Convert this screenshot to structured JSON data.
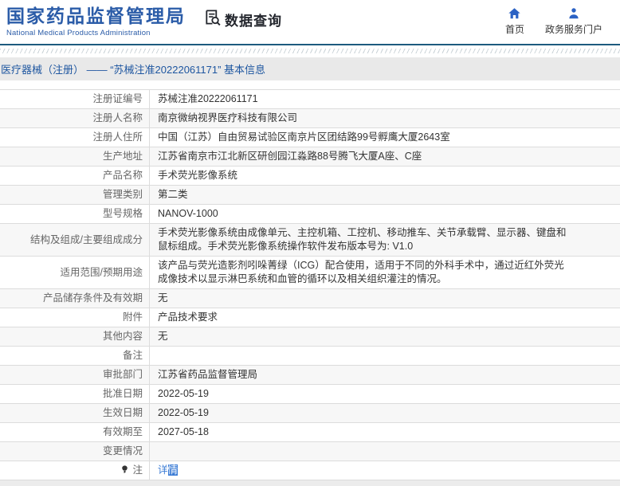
{
  "header": {
    "logo_title": "国家药品监督管理局",
    "logo_subtitle": "National Medical Products Administration",
    "site_title": "数据查询",
    "nav": [
      {
        "label": "首页"
      },
      {
        "label": "政务服务门户"
      }
    ]
  },
  "breadcrumb": "医疗器械（注册） —— “苏械注准20222061171” 基本信息",
  "table": {
    "rows": [
      {
        "label": "注册证编号",
        "value": "苏械注准20222061171"
      },
      {
        "label": "注册人名称",
        "value": "南京微纳视界医疗科技有限公司"
      },
      {
        "label": "注册人住所",
        "value": "中国（江苏）自由贸易试验区南京片区团结路99号孵鹰大厦2643室"
      },
      {
        "label": "生产地址",
        "value": "江苏省南京市江北新区研创园江淼路88号腾飞大厦A座、C座"
      },
      {
        "label": "产品名称",
        "value": "手术荧光影像系统"
      },
      {
        "label": "管理类别",
        "value": "第二类"
      },
      {
        "label": "型号规格",
        "value": "NANOV-1000"
      },
      {
        "label": "结构及组成/主要组成成分",
        "value": "手术荧光影像系统由成像单元、主控机箱、工控机、移动推车、关节承载臂、显示器、键盘和鼠标组成。手术荧光影像系统操作软件发布版本号为: V1.0"
      },
      {
        "label": "适用范围/预期用途",
        "value": "该产品与荧光造影剂吲哚菁绿（ICG）配合使用，适用于不同的外科手术中，通过近红外荧光成像技术以显示淋巴系统和血管的循环以及相关组织灌注的情况。"
      },
      {
        "label": "产品储存条件及有效期",
        "value": "无"
      },
      {
        "label": "附件",
        "value": "产品技术要求"
      },
      {
        "label": "其他内容",
        "value": "无"
      },
      {
        "label": "备注",
        "value": ""
      },
      {
        "label": "审批部门",
        "value": "江苏省药品监督管理局"
      },
      {
        "label": "批准日期",
        "value": "2022-05-19"
      },
      {
        "label": "生效日期",
        "value": "2022-05-19"
      },
      {
        "label": "有效期至",
        "value": "2027-05-18"
      },
      {
        "label": "变更情况",
        "value": ""
      },
      {
        "label": "注",
        "value": "详情",
        "type": "link",
        "label_icon": "note-icon",
        "selected_from": 1
      }
    ]
  },
  "colors": {
    "brand": "#2b5ca8",
    "icon-blue": "#2b62c4",
    "link": "#3a7bd5",
    "divider": "#1d5b7f",
    "row-alt": "#f7f7f7",
    "border": "#dcdcdc"
  }
}
